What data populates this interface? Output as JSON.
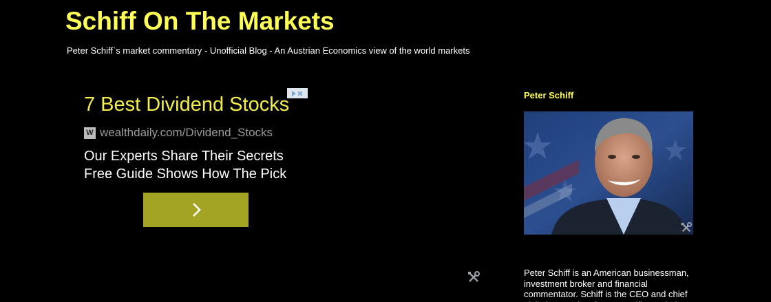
{
  "header": {
    "title": "Schiff On The Markets",
    "description": "Peter Schiff`s market commentary - Unofficial Blog - An Austrian Economics view of the world markets"
  },
  "ad": {
    "headline": "7 Best Dividend Stocks",
    "url": "wealthdaily.com/Dividend_Stocks",
    "favicon": "W",
    "line1": "Our Experts Share Their Secrets",
    "line2": "Free Guide Shows How The Pick",
    "button_icon": "chevron-right-icon",
    "choices_icon": "adchoices-icon"
  },
  "sidebar": {
    "title": "Peter Schiff",
    "text": "Peter Schiff is an American businessman, investment broker and financial commentator. Schiff is the CEO and chief global strategist of Euro Pacific Capital"
  },
  "colors": {
    "title": "#ffff55",
    "ad_headline": "#f4ee4a",
    "ad_button": "#a3a324",
    "background": "#000000"
  }
}
